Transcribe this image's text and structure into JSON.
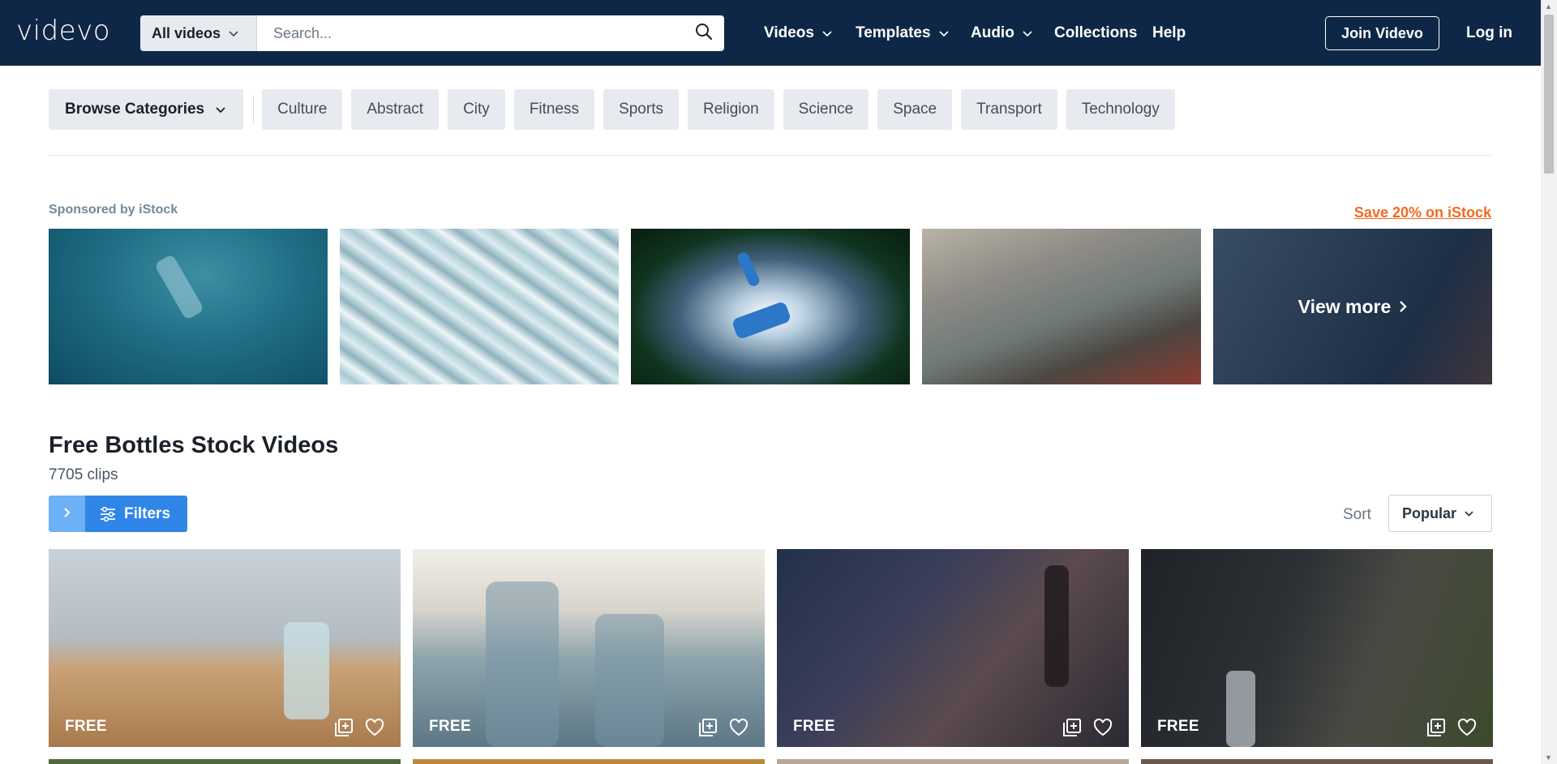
{
  "header": {
    "logo": "videvo",
    "search_type": "All videos",
    "search_placeholder": "Search...",
    "nav": [
      {
        "label": "Videos",
        "dropdown": true
      },
      {
        "label": "Templates",
        "dropdown": true
      },
      {
        "label": "Audio",
        "dropdown": true
      },
      {
        "label": "Collections",
        "dropdown": false
      },
      {
        "label": "Help",
        "dropdown": false
      }
    ],
    "join_label": "Join Videvo",
    "login_label": "Log in",
    "bg_color": "#0f2747"
  },
  "categories": {
    "browse_label": "Browse Categories",
    "items": [
      "Culture",
      "Abstract",
      "City",
      "Fitness",
      "Sports",
      "Religion",
      "Science",
      "Space",
      "Transport",
      "Technology"
    ]
  },
  "sponsored": {
    "label": "Sponsored by iStock",
    "link": "Save 20% on iStock",
    "view_more": "View more",
    "link_color": "#f36a21"
  },
  "main": {
    "title": "Free Bottles Stock Videos",
    "clip_count": "7705 clips",
    "filters_label": "Filters",
    "sort_label": "Sort",
    "sort_value": "Popular",
    "accent_color": "#2f86e8"
  },
  "videos": [
    {
      "badge": "FREE"
    },
    {
      "badge": "FREE"
    },
    {
      "badge": "FREE"
    },
    {
      "badge": "FREE"
    }
  ]
}
